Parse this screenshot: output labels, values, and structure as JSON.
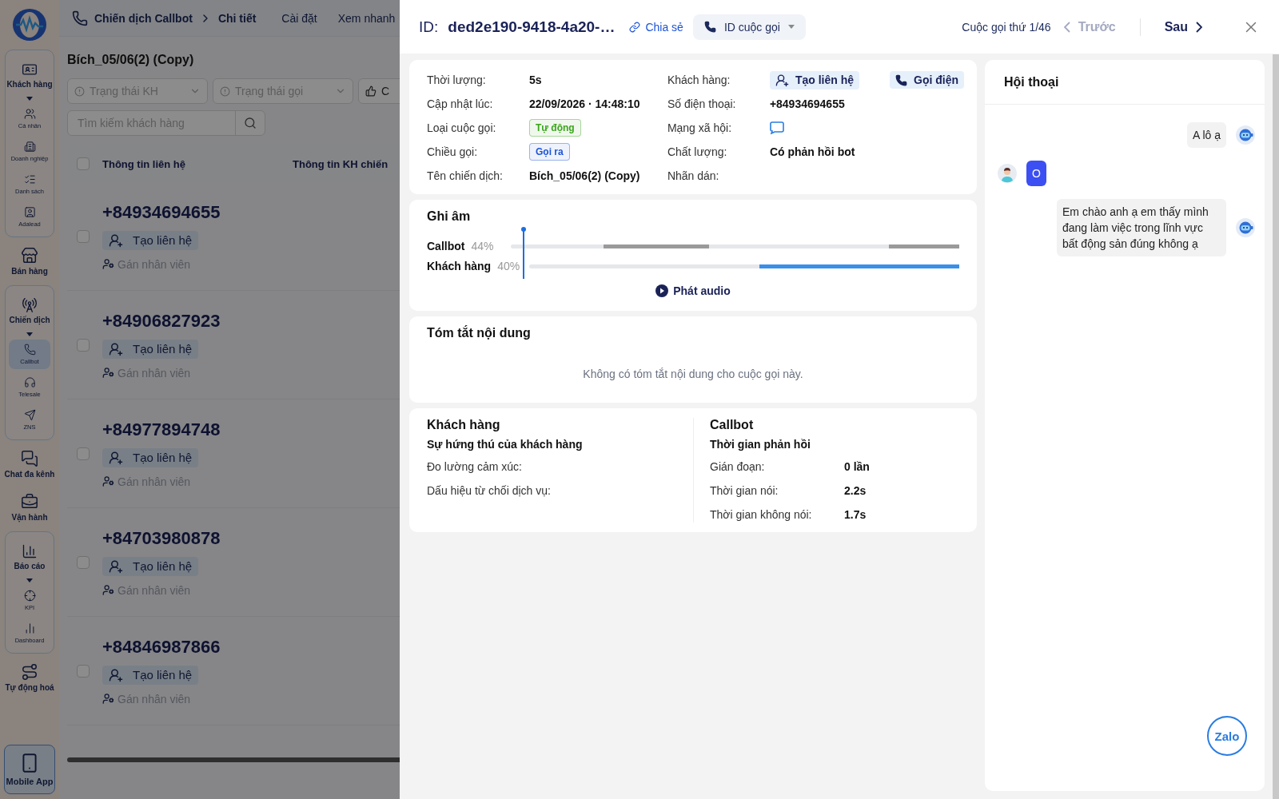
{
  "sidebar": {
    "items": [
      {
        "label": "Khách hàng",
        "kind": "group",
        "expanded": true,
        "children": [
          {
            "label": "Cá nhân",
            "selected": false
          },
          {
            "label": "Doanh nghiệp",
            "selected": false
          },
          {
            "label": "Danh sách",
            "selected": false
          },
          {
            "label": "Adalead",
            "selected": false
          }
        ]
      },
      {
        "label": "Bán hàng",
        "kind": "link"
      },
      {
        "label": "Chiến dịch",
        "kind": "group",
        "expanded": true,
        "children": [
          {
            "label": "Callbot",
            "selected": true
          },
          {
            "label": "Telesale",
            "selected": false
          },
          {
            "label": "ZNS",
            "selected": false
          }
        ]
      },
      {
        "label": "Chat đa kênh",
        "kind": "link"
      },
      {
        "label": "Vận hành",
        "kind": "link"
      },
      {
        "label": "Báo cáo",
        "kind": "group",
        "expanded": true,
        "children": [
          {
            "label": "KPI",
            "selected": false
          },
          {
            "label": "Dashboard",
            "selected": false
          }
        ]
      },
      {
        "label": "Tự động hoá",
        "kind": "link"
      },
      {
        "label": "Mobile App",
        "kind": "app"
      }
    ]
  },
  "app": {
    "breadcrumb": [
      "Chiến dịch Callbot",
      "Chi tiết"
    ],
    "header_tabs": [
      "Cài đặt",
      "Xem nhanh"
    ],
    "campaign_title": "Bích_05/06(2) (Copy)",
    "filters": [
      {
        "placeholder": "Trạng thái KH",
        "kind": "status"
      },
      {
        "placeholder": "Trạng thái gọi",
        "kind": "status"
      },
      {
        "placeholder": "C",
        "kind": "rating"
      }
    ],
    "search": {
      "placeholder": "Tìm kiếm khách hàng"
    },
    "select_all": {
      "checked": false
    },
    "columns": [
      "Thông tin liên hệ",
      "Thông tin KH chiến"
    ],
    "rows": [
      {
        "phone": "+84934694655",
        "create": "Tạo liên hệ",
        "assign": "Gán nhân viên",
        "checked": false
      },
      {
        "phone": "+84906827923",
        "create": "Tạo liên hệ",
        "assign": "Gán nhân viên",
        "checked": false
      },
      {
        "phone": "+84977894748",
        "create": "Tạo liên hệ",
        "assign": "Gán nhân viên",
        "checked": false
      },
      {
        "phone": "+84703980878",
        "create": "Tạo liên hệ",
        "assign": "Gán nhân viên",
        "checked": false
      },
      {
        "phone": "+84846987866",
        "create": "Tạo liên hệ",
        "assign": "Gán nhân viên",
        "checked": false
      }
    ]
  },
  "drawer": {
    "id_label": "ID:",
    "id_value": "ded2e190-9418-4a20-…",
    "share": "Chia sẻ",
    "call_id_select": "ID cuộc gọi",
    "counter": "Cuộc gọi thứ 1/46",
    "prev": {
      "label": "Trước",
      "disabled": true
    },
    "next": {
      "label": "Sau",
      "disabled": false
    },
    "info_left": [
      {
        "label": "Thời lượng:",
        "value": "5s",
        "kind": "text"
      },
      {
        "label": "Cập nhật lúc:",
        "value": "22/09/2026 · 14:48:10",
        "kind": "text"
      },
      {
        "label": "Loại cuộc gọi:",
        "value": "Tự động",
        "kind": "tag",
        "color": "#3aa51c"
      },
      {
        "label": "Chiều gọi:",
        "value": "Gọi ra",
        "kind": "tag",
        "color": "#1d54d6"
      },
      {
        "label": "Tên chiến dịch:",
        "value": "Bích_05/06(2) (Copy)",
        "kind": "text"
      }
    ],
    "info_right": [
      {
        "label": "Khách hàng:",
        "kind": "actions",
        "actions": [
          "Tạo liên hệ",
          "Gọi điện"
        ]
      },
      {
        "label": "Số điện thoại:",
        "value": "+84934694655",
        "kind": "text"
      },
      {
        "label": "Mạng xã hội:",
        "kind": "social"
      },
      {
        "label": "Chất lượng:",
        "value": "Có phản hồi bot",
        "kind": "text"
      },
      {
        "label": "Nhãn dán:",
        "kind": "empty"
      }
    ],
    "recording": {
      "title": "Ghi âm",
      "tracks": [
        {
          "name": "Callbot",
          "share": "44%",
          "kind": "bot"
        },
        {
          "name": "Khách hàng",
          "share": "40%",
          "kind": "customer"
        }
      ],
      "play": "Phát audio"
    },
    "summary": {
      "title": "Tóm tắt nội dung",
      "empty": "Không có tóm tắt nội dung cho cuộc gọi này."
    },
    "analysis": [
      {
        "title": "Khách hàng",
        "subtitle": "Sự hứng thú của khách hàng",
        "rows": [
          {
            "label": "Đo lường cảm xúc:"
          },
          {
            "label": "Dấu hiệu từ chối dịch vụ:"
          }
        ]
      },
      {
        "title": "Callbot",
        "subtitle": "Thời gian phản hồi",
        "rows": [
          {
            "label": "Gián đoạn:",
            "value": "0 lần"
          },
          {
            "label": "Thời gian nói:",
            "value": "2.2s"
          },
          {
            "label": "Thời gian không nói:",
            "value": "1.7s"
          }
        ]
      }
    ],
    "conversation": {
      "title": "Hội thoại",
      "messages": [
        {
          "kind": "bot",
          "text": "A lô ạ"
        },
        {
          "kind": "customer",
          "text": "O"
        },
        {
          "kind": "bot",
          "text": "Em chào anh ạ em thấy mình đang làm việc trong lĩnh vực bất động sản đúng không ạ"
        }
      ]
    },
    "zalo_button": "Zalo"
  }
}
